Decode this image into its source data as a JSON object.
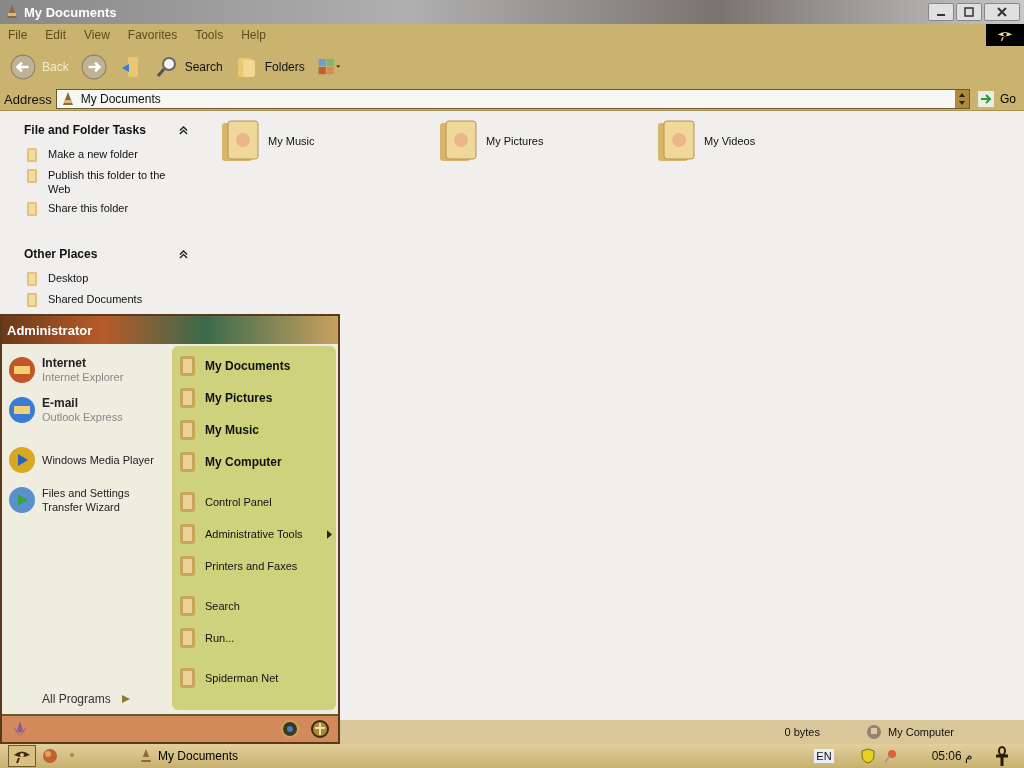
{
  "window": {
    "title": "My Documents"
  },
  "menu_bar": [
    "File",
    "Edit",
    "View",
    "Favorites",
    "Tools",
    "Help"
  ],
  "toolbar": {
    "back": "Back",
    "search": "Search",
    "folders": "Folders"
  },
  "address": {
    "label": "Address",
    "value": "My Documents",
    "go": "Go"
  },
  "task_panes": [
    {
      "title": "File and Folder Tasks",
      "expanded": true,
      "items": [
        "Make a new folder",
        "Publish this folder to the Web",
        "Share this folder"
      ]
    },
    {
      "title": "Other Places",
      "expanded": true,
      "items": [
        "Desktop",
        "Shared Documents"
      ]
    }
  ],
  "folders": [
    {
      "name": "My Music"
    },
    {
      "name": "My Pictures"
    },
    {
      "name": "My Videos"
    }
  ],
  "status_bar": {
    "size": "0 bytes",
    "zone": "My Computer"
  },
  "start_menu": {
    "user": "Administrator",
    "pinned": [
      {
        "title": "Internet",
        "subtitle": "Internet Explorer"
      },
      {
        "title": "E-mail",
        "subtitle": "Outlook Express"
      }
    ],
    "recent": [
      "Windows Media Player",
      "Files and Settings Transfer Wizard"
    ],
    "all_programs": "All Programs",
    "place_groups": [
      [
        {
          "label": "My Documents",
          "bold": true,
          "submenu": false
        },
        {
          "label": "My Pictures",
          "bold": true,
          "submenu": false
        },
        {
          "label": "My Music",
          "bold": true,
          "submenu": false
        },
        {
          "label": "My Computer",
          "bold": true,
          "submenu": false
        }
      ],
      [
        {
          "label": "Control Panel",
          "bold": false,
          "submenu": false
        },
        {
          "label": "Administrative Tools",
          "bold": false,
          "submenu": true
        },
        {
          "label": "Printers and Faxes",
          "bold": false,
          "submenu": false
        }
      ],
      [
        {
          "label": "Search",
          "bold": false,
          "submenu": false
        },
        {
          "label": "Run...",
          "bold": false,
          "submenu": false
        }
      ],
      [
        {
          "label": "Spiderman Net",
          "bold": false,
          "submenu": false
        }
      ]
    ]
  },
  "taskbar": {
    "tasks": [
      {
        "label": "My Documents"
      }
    ],
    "language": "EN",
    "clock": "05:06 م"
  }
}
